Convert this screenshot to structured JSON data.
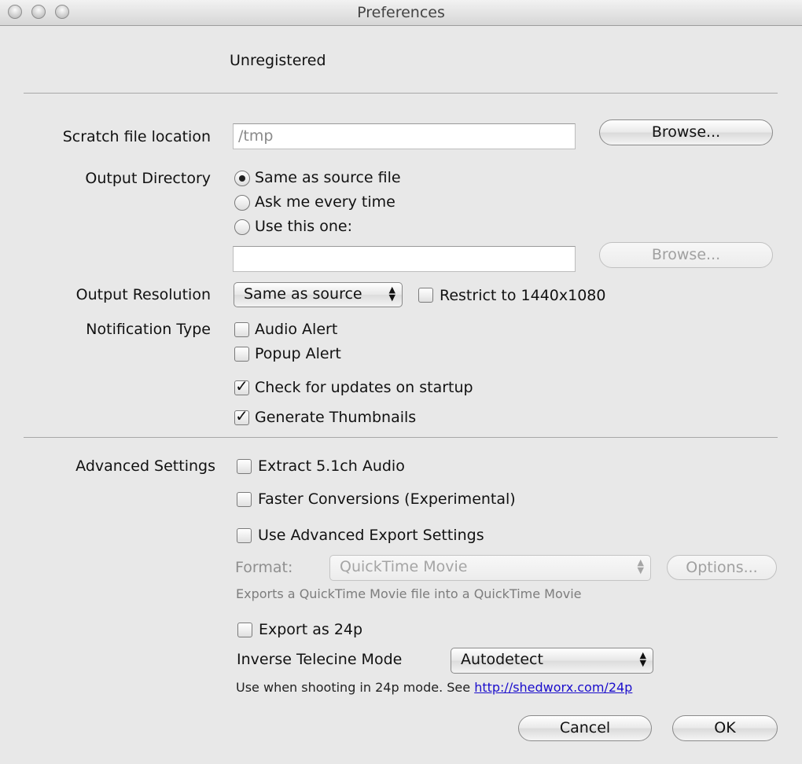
{
  "window": {
    "title": "Preferences",
    "controls": [
      "close-icon",
      "minimize-icon",
      "zoom-icon"
    ]
  },
  "registration": {
    "status": "Unregistered"
  },
  "scratch": {
    "label": "Scratch file location",
    "value": "/tmp",
    "browse_label": "Browse..."
  },
  "output_directory": {
    "label": "Output Directory",
    "options": [
      {
        "label": "Same as source file",
        "selected": true
      },
      {
        "label": "Ask me every time",
        "selected": false
      },
      {
        "label": "Use this one:",
        "selected": false
      }
    ],
    "path_value": "",
    "browse_label": "Browse..."
  },
  "output_resolution": {
    "label": "Output Resolution",
    "selected": "Same as source",
    "restrict_label": "Restrict to 1440x1080",
    "restrict_checked": false
  },
  "notification": {
    "label": "Notification Type",
    "audio_label": "Audio Alert",
    "audio_checked": false,
    "popup_label": "Popup Alert",
    "popup_checked": false
  },
  "general": {
    "updates_label": "Check for updates on startup",
    "updates_checked": true,
    "thumbnails_label": "Generate Thumbnails",
    "thumbnails_checked": true
  },
  "advanced": {
    "label": "Advanced Settings",
    "extract_label": "Extract 5.1ch Audio",
    "extract_checked": false,
    "faster_label": "Faster Conversions (Experimental)",
    "faster_checked": false,
    "advanced_export_label": "Use Advanced Export Settings",
    "advanced_export_checked": false,
    "format_label": "Format:",
    "format_value": "QuickTime Movie",
    "options_label": "Options...",
    "format_hint": "Exports a QuickTime Movie file into a QuickTime Movie",
    "export24p_label": "Export as 24p",
    "export24p_checked": false,
    "telecine_label": "Inverse Telecine Mode",
    "telecine_value": "Autodetect",
    "hint_prefix": "Use when shooting in 24p mode. See ",
    "hint_link": "http://shedworx.com/24p"
  },
  "footer": {
    "cancel_label": "Cancel",
    "ok_label": "OK"
  },
  "colors": {
    "window_bg": "#e8e8e8",
    "link": "#1a0dcc"
  }
}
